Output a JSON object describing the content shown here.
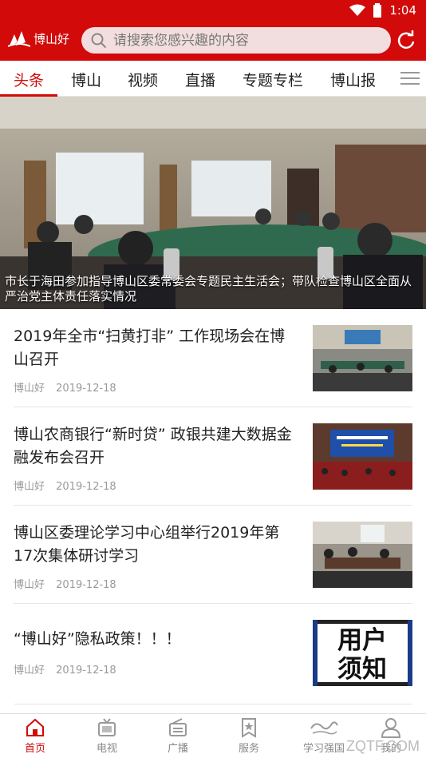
{
  "status_bar": {
    "time": "1:04"
  },
  "header": {
    "logo_text": "博山好",
    "search_placeholder": "请搜索您感兴趣的内容"
  },
  "tabs": [
    {
      "label": "头条",
      "active": true
    },
    {
      "label": "博山",
      "active": false
    },
    {
      "label": "视频",
      "active": false
    },
    {
      "label": "直播",
      "active": false
    },
    {
      "label": "专题专栏",
      "active": false
    },
    {
      "label": "博山报",
      "active": false
    }
  ],
  "banner": {
    "caption": "市长于海田参加指导博山区委常委会专题民主生活会；带队检查博山区全面从严治党主体责任落实情况"
  },
  "news": [
    {
      "title": "2019年全市“扫黄打非” 工作现场会在博山召开",
      "source": "博山好",
      "date": "2019-12-18"
    },
    {
      "title": "博山农商银行“新时贷” 政银共建大数据金融发布会召开",
      "source": "博山好",
      "date": "2019-12-18"
    },
    {
      "title": "博山区委理论学习中心组举行2019年第17次集体研讨学习",
      "source": "博山好",
      "date": "2019-12-18"
    },
    {
      "title": "“博山好”隐私政策！！！",
      "source": "博山好",
      "date": "2019-12-18",
      "thumb_text_1": "用户",
      "thumb_text_2": "须知"
    }
  ],
  "bottom_nav": [
    {
      "label": "首页",
      "icon": "home-icon",
      "active": true
    },
    {
      "label": "电视",
      "icon": "tv-icon",
      "active": false
    },
    {
      "label": "广播",
      "icon": "radio-icon",
      "active": false
    },
    {
      "label": "服务",
      "icon": "star-bookmark-icon",
      "active": false
    },
    {
      "label": "学习强国",
      "icon": "xuexi-icon",
      "active": false
    },
    {
      "label": "我的",
      "icon": "user-icon",
      "active": false
    }
  ],
  "colors": {
    "brand_red": "#d20a0a"
  },
  "watermark": "ZQTF.COM"
}
